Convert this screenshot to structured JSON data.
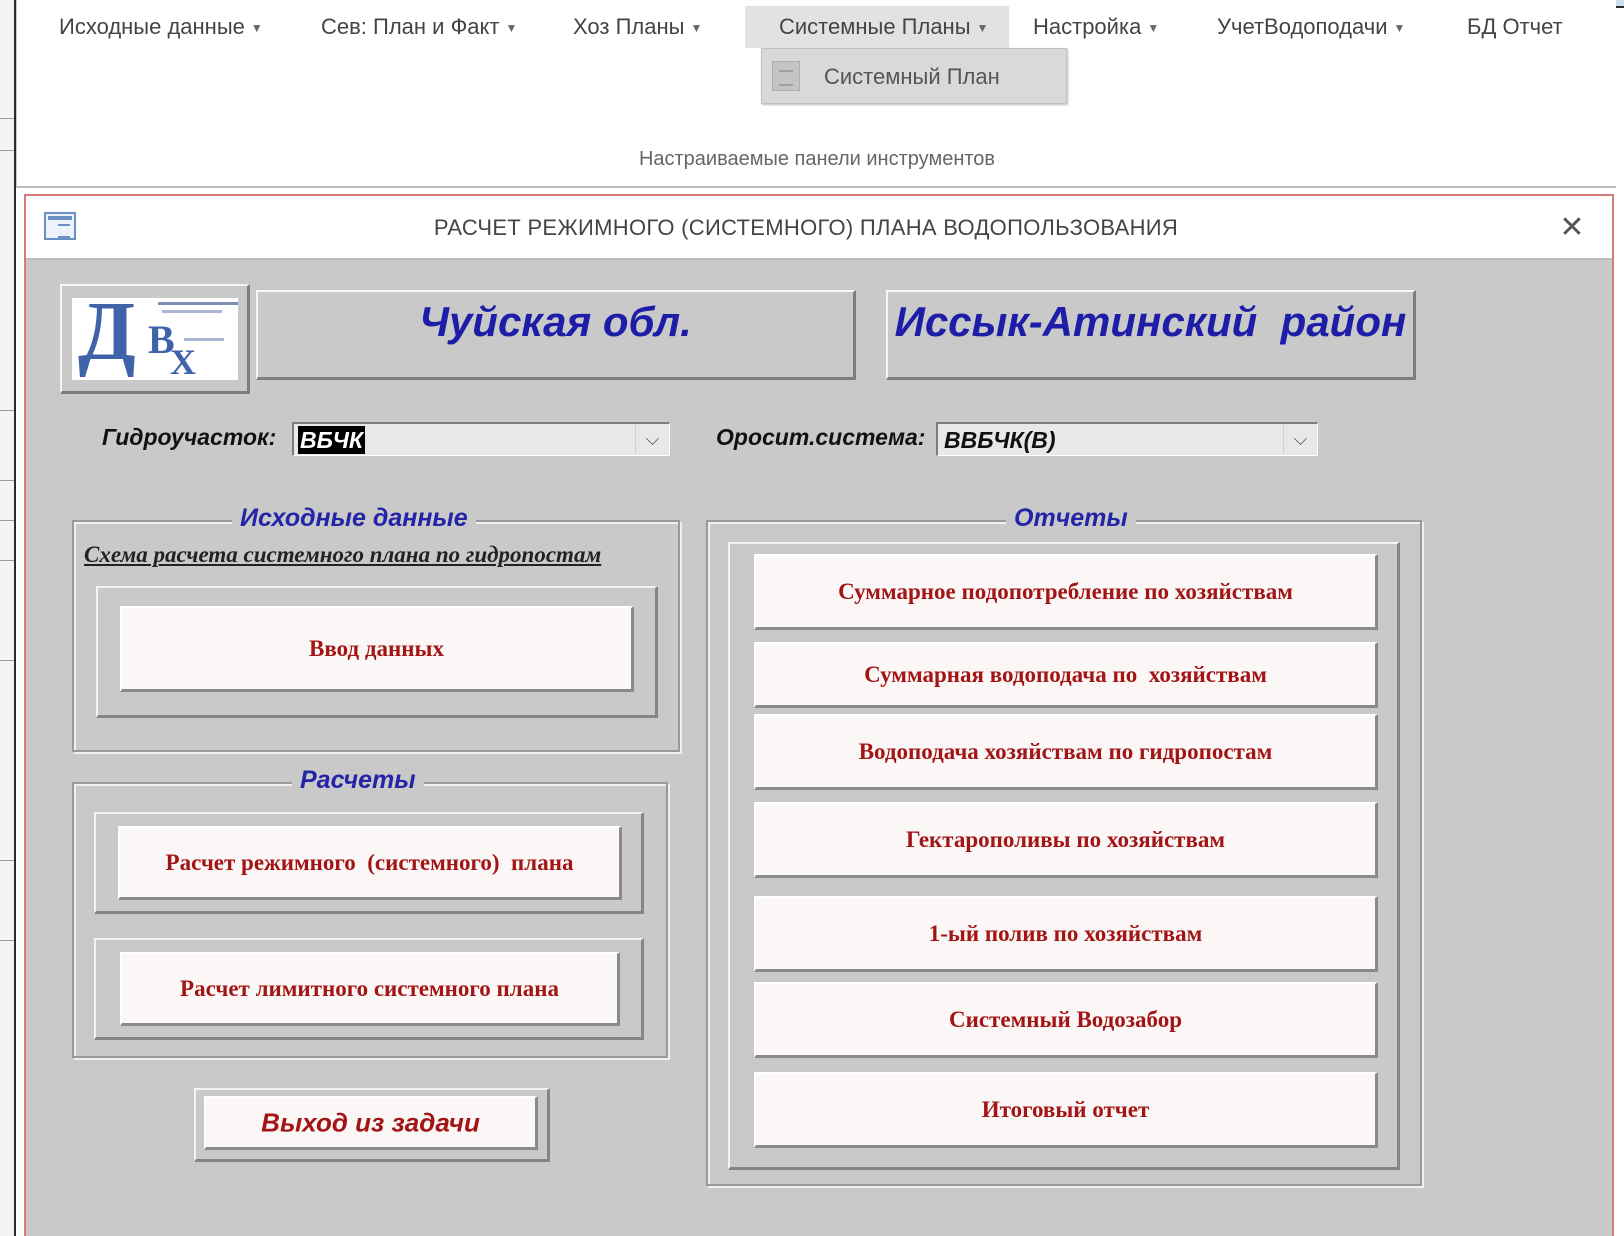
{
  "menubar": {
    "items": [
      {
        "label": "Исходные данные"
      },
      {
        "label": "Сев: План и Факт"
      },
      {
        "label": "Хоз Планы"
      },
      {
        "label": "Системные Планы"
      },
      {
        "label": "Настройка"
      },
      {
        "label": "УчетВодоподачи"
      },
      {
        "label": "БД Отчет"
      }
    ],
    "dropdown_item": "Системный План",
    "caption": "Настраиваемые панели инструментов"
  },
  "form": {
    "title": "РАСЧЕТ РЕЖИМНОГО (СИСТЕМНОГО) ПЛАНА ВОДОПОЛЬЗОВАНИЯ",
    "close_glyph": "✕",
    "region": "Чуйская обл.",
    "district": "Иссык-Атинский  район",
    "hydro_label": "Гидроучасток:",
    "hydro_value": "ВБЧК",
    "system_label": "Оросит.система:",
    "system_value": "ВВБЧК(В)",
    "source_group": {
      "legend": "Исходные данные",
      "scheme_link": "Схема расчета системного плана  по гидропостам",
      "input_button": "Ввод данных"
    },
    "calc_group": {
      "legend": "Расчеты",
      "mode_plan_button": "Расчет режимного  (системного)  плана",
      "limit_plan_button": "Расчет лимитного системного плана"
    },
    "exit_button": "Выход из задачи",
    "reports_group": {
      "legend": "Отчеты",
      "buttons": [
        "Суммарное подопотребление по хозяйствам",
        "Суммарная водоподача по  хозяйствам",
        "Водоподача хозяйствам по гидропостам",
        "Гектарополивы по хозяйствам",
        "1-ый полив по хозяйствам",
        "Системный Водозабор",
        "Итоговый отчет"
      ]
    }
  },
  "colors": {
    "form_bg": "#c9c9c9",
    "title_blue": "#1d1da8",
    "button_text": "#a31515"
  },
  "icons": {
    "title_icon": "form-icon",
    "close": "close-icon",
    "combo_arrow": "chevron-down-icon",
    "menu_caret": "caret-down-icon"
  }
}
